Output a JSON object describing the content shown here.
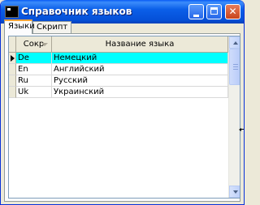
{
  "window": {
    "title": "Справочник языков",
    "controls": {
      "minimize": "minimize",
      "maximize": "maximize",
      "close": "✕"
    }
  },
  "tabs": [
    {
      "label": "Языки",
      "active": true
    },
    {
      "label": "Скрипт",
      "active": false
    }
  ],
  "grid": {
    "columns": [
      "Сокр",
      "Название языка"
    ],
    "sorted_column": "Сокр",
    "rows": [
      {
        "code": "De",
        "name": "Немецкий",
        "selected": true
      },
      {
        "code": "En",
        "name": "Английский",
        "selected": false
      },
      {
        "code": "Ru",
        "name": "Русский",
        "selected": false
      },
      {
        "code": "Uk",
        "name": "Украинский",
        "selected": false
      }
    ]
  },
  "colors": {
    "titlebar": "#0550d8",
    "selected_row": "#00ffff",
    "active_tab_accent": "#f0a43a"
  },
  "icons": [
    "app-icon",
    "minimize-icon",
    "maximize-icon",
    "close-icon",
    "sort-icon",
    "row-indicator-icon",
    "scroll-up-icon",
    "scroll-down-icon"
  ]
}
